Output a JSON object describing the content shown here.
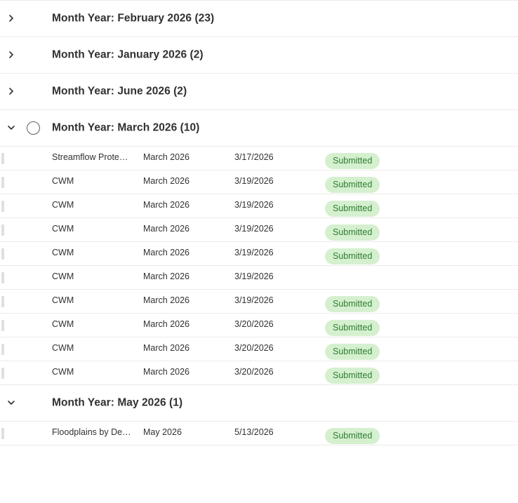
{
  "groups": [
    {
      "title": "Month Year: February 2026 (23)",
      "expanded": false,
      "rows": []
    },
    {
      "title": "Month Year: January 2026 (2)",
      "expanded": false,
      "rows": []
    },
    {
      "title": "Month Year: June 2026 (2)",
      "expanded": false,
      "rows": []
    },
    {
      "title": "Month Year: March 2026 (10)",
      "expanded": true,
      "show_select": true,
      "rows": [
        {
          "title": "Streamflow Protecti...",
          "month": "March 2026",
          "date": "3/17/2026",
          "status": "Submitted"
        },
        {
          "title": "CWM",
          "month": "March 2026",
          "date": "3/19/2026",
          "status": "Submitted"
        },
        {
          "title": "CWM",
          "month": "March 2026",
          "date": "3/19/2026",
          "status": "Submitted"
        },
        {
          "title": "CWM",
          "month": "March 2026",
          "date": "3/19/2026",
          "status": "Submitted"
        },
        {
          "title": "CWM",
          "month": "March 2026",
          "date": "3/19/2026",
          "status": "Submitted"
        },
        {
          "title": "CWM",
          "month": "March 2026",
          "date": "3/19/2026",
          "status": ""
        },
        {
          "title": "CWM",
          "month": "March 2026",
          "date": "3/19/2026",
          "status": "Submitted"
        },
        {
          "title": "CWM",
          "month": "March 2026",
          "date": "3/20/2026",
          "status": "Submitted"
        },
        {
          "title": "CWM",
          "month": "March 2026",
          "date": "3/20/2026",
          "status": "Submitted"
        },
        {
          "title": "CWM",
          "month": "March 2026",
          "date": "3/20/2026",
          "status": "Submitted"
        }
      ]
    },
    {
      "title": "Month Year: May 2026 (1)",
      "expanded": true,
      "rows": [
        {
          "title": "Floodplains by Desi...",
          "month": "May 2026",
          "date": "5/13/2026",
          "status": "Submitted"
        }
      ]
    }
  ],
  "icons": {
    "collapsed": "chevron-right-icon",
    "expanded": "chevron-down-icon",
    "select": "circle-select-icon"
  },
  "colors": {
    "badge_bg": "#d5f0cf",
    "badge_text": "#2e7d32",
    "divider": "#edebe9",
    "text": "#323130"
  }
}
